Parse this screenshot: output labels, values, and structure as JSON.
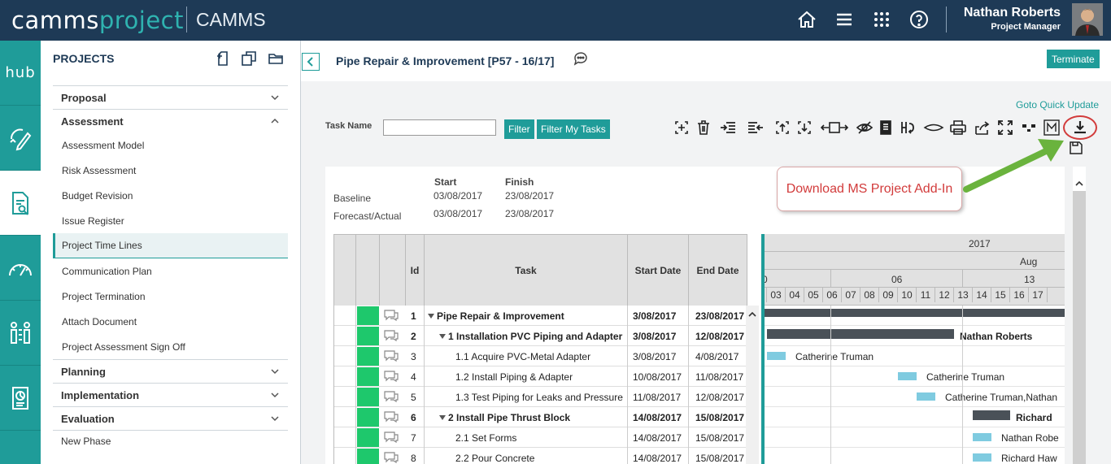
{
  "header": {
    "logo_part1": "camms",
    "logo_part2": "project",
    "brand": "CAMMS",
    "user_name": "Nathan Roberts",
    "user_role": "Project Manager"
  },
  "rail": {
    "hub_label": "hub"
  },
  "panel": {
    "title": "PROJECTS",
    "sections": [
      {
        "label": "Proposal",
        "expanded": false
      },
      {
        "label": "Assessment",
        "expanded": true
      },
      {
        "label": "Planning",
        "expanded": false
      },
      {
        "label": "Implementation",
        "expanded": false
      },
      {
        "label": "Evaluation",
        "expanded": false
      }
    ],
    "assessment_items": [
      "Assessment Model",
      "Risk Assessment",
      "Budget Revision",
      "Issue Register",
      "Project Time Lines",
      "Communication Plan",
      "Project Termination",
      "Attach Document",
      "Project Assessment Sign Off"
    ],
    "active_item": "Project Time Lines",
    "new_phase": "New Phase"
  },
  "main": {
    "title": "Pipe Repair & Improvement [P57 - 16/17]",
    "terminate_label": "Terminate",
    "quick_update": "Goto Quick Update",
    "task_name_label": "Task Name",
    "task_name_value": "",
    "filter_label": "Filter",
    "filter_my_tasks_label": "Filter My Tasks"
  },
  "baseline": {
    "start_header": "Start",
    "finish_header": "Finish",
    "rows": [
      {
        "label": "Baseline",
        "start": "03/08/2017",
        "finish": "23/08/2017"
      },
      {
        "label": "Forecast/Actual",
        "start": "03/08/2017",
        "finish": "23/08/2017"
      }
    ]
  },
  "grid": {
    "columns": [
      "Id",
      "Task",
      "Start Date",
      "End Date"
    ],
    "rows": [
      {
        "id": "1",
        "task": "Pipe Repair & Improvement",
        "start": "3/08/2017",
        "end": "23/08/2017",
        "bold": true,
        "level": 0,
        "caret": true
      },
      {
        "id": "2",
        "task": "1 Installation PVC Piping and Adapter",
        "start": "3/08/2017",
        "end": "12/08/2017",
        "bold": true,
        "level": 1,
        "caret": true
      },
      {
        "id": "3",
        "task": "1.1 Acquire PVC-Metal Adapter",
        "start": "3/08/2017",
        "end": "4/08/2017",
        "bold": false,
        "level": 2,
        "caret": false
      },
      {
        "id": "4",
        "task": "1.2 Install Piping & Adapter",
        "start": "10/08/2017",
        "end": "11/08/2017",
        "bold": false,
        "level": 2,
        "caret": false
      },
      {
        "id": "5",
        "task": "1.3 Test Piping for Leaks and Pressure",
        "start": "11/08/2017",
        "end": "12/08/2017",
        "bold": false,
        "level": 2,
        "caret": false
      },
      {
        "id": "6",
        "task": "2 Install Pipe Thrust Block",
        "start": "14/08/2017",
        "end": "15/08/2017",
        "bold": true,
        "level": 1,
        "caret": true
      },
      {
        "id": "7",
        "task": "2.1 Set Forms",
        "start": "14/08/2017",
        "end": "15/08/2017",
        "bold": false,
        "level": 2,
        "caret": false
      },
      {
        "id": "8",
        "task": "2.2 Pour Concrete",
        "start": "14/08/2017",
        "end": "15/08/2017",
        "bold": false,
        "level": 2,
        "caret": false
      }
    ]
  },
  "gantt": {
    "year": "2017",
    "month": "Aug",
    "week_labels": [
      "06",
      "13"
    ],
    "days": [
      "03",
      "04",
      "05",
      "06",
      "07",
      "08",
      "09",
      "10",
      "11",
      "12",
      "13",
      "14",
      "15",
      "16",
      "17"
    ],
    "bar_labels": [
      "",
      "Nathan Roberts",
      "Catherine Truman",
      "Catherine Truman",
      "Catherine Truman,Nathan",
      "Richard",
      "Nathan Robe",
      "Richard Haw"
    ]
  },
  "callout": {
    "text": "Download MS Project Add-In",
    "color": "#d23b3b"
  },
  "colors": {
    "header_bg": "#1e3a56",
    "accent": "#1f9c99",
    "status_green": "#1ec86c"
  }
}
